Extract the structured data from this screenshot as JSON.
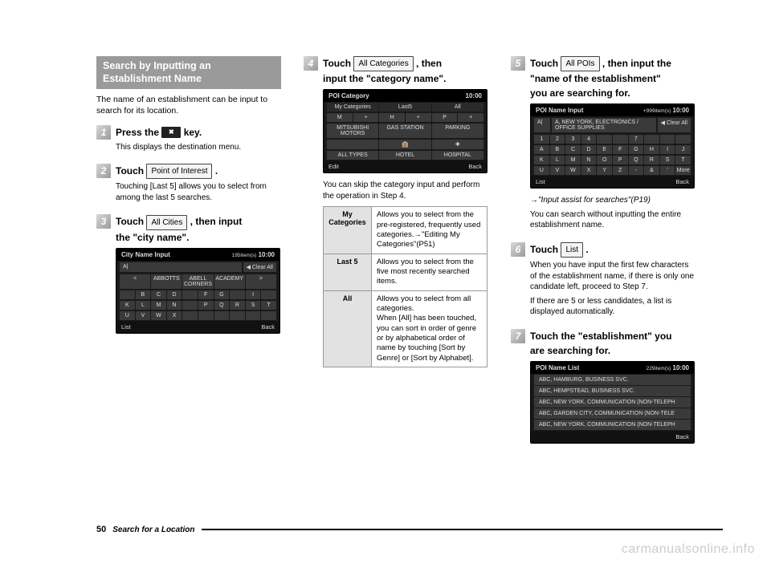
{
  "section_title_l1": "Search by Inputting an",
  "section_title_l2": "Establishment Name",
  "intro": "The name of an establishment can be input to search for its location.",
  "step1": {
    "main_a": "Press the ",
    "key": "✖",
    "main_b": " key.",
    "sub": "This displays the destination menu."
  },
  "step2": {
    "main_a": "Touch ",
    "btn": "Point of Interest",
    "main_b": " .",
    "sub": "Touching [Last 5] allows you to select from among the last 5 searches."
  },
  "step3": {
    "main_a": "Touch ",
    "btn": "All Cities",
    "main_b": " , then input",
    "main_c": "the \"city name\"."
  },
  "screen3": {
    "title": "City Name Input",
    "count": "195item(s)",
    "time": "10:00",
    "input": "A|",
    "clear": "◀ Clear All",
    "r1a": "ABBOTTS",
    "r1b": "ABELL CORNERS",
    "r1c": "ACADEMY",
    "k": [
      "B",
      "C",
      "D",
      "F",
      "G",
      "I",
      "K",
      "L",
      "M",
      "N",
      "P",
      "Q",
      "R",
      "S",
      "T",
      "U",
      "V",
      "W",
      "X"
    ],
    "f1": "List",
    "f2": "Back"
  },
  "step4": {
    "main_a": "Touch ",
    "btn": "All Categories",
    "main_b": " , then",
    "main_c": "input the \"category name\"."
  },
  "screen4": {
    "title": "POI Category",
    "time": "10:00",
    "t1": "My Categories",
    "t2": "Last5",
    "t3": "All",
    "r1a": "M",
    "r1b": "+",
    "r1c": "H",
    "r1d": "+",
    "r1e": "P",
    "r1f": "+",
    "r2a": "MITSUBISHI MOTORS",
    "r2b": "GAS STATION",
    "r2c": "PARKING",
    "r3a": "",
    "r3b": "🏨",
    "r3c": "✚",
    "r4a": "ALL TYPES",
    "r4b": "HOTEL",
    "r4c": "HOSPITAL",
    "f1": "Edit",
    "f2": "Back"
  },
  "step4_sub": "You can skip the category input and perform the operation in Step 4.",
  "table": {
    "r1l": "My Categories",
    "r1d": "Allows you to select from the pre-registered, frequently used categories.→\"Editing My Categories\"(P51)",
    "r2l": "Last 5",
    "r2d": "Allows you to select from the five most recently searched items.",
    "r3l": "All",
    "r3d": "Allows you to select from all categories.\nWhen [All] has been touched, you can sort in order of genre or by alphabetical order of name by touching [Sort by Genre] or [Sort by Alphabet]."
  },
  "step5": {
    "main_a": "Touch ",
    "btn": "All POIs",
    "main_b": " , then input the",
    "main_c": "\"name of the establishment\"",
    "main_d": "you are searching for."
  },
  "screen5": {
    "title": "POI Name Input",
    "count": "+999item(s)",
    "time": "10:00",
    "input": "A|",
    "sug": "A, NEW YORK, ELECTRONICS / OFFICE SUPPLIES",
    "clear": "◀ Clear All",
    "k1": [
      "1",
      "2",
      "3",
      "4",
      "",
      "",
      "7"
    ],
    "k2": [
      "A",
      "B",
      "C",
      "D",
      "E",
      "F",
      "G",
      "H",
      "I",
      "J"
    ],
    "k3": [
      "K",
      "L",
      "M",
      "N",
      "O",
      "P",
      "Q",
      "R",
      "S",
      "T"
    ],
    "k4": [
      "U",
      "V",
      "W",
      "X",
      "Y",
      "Z",
      "-",
      "&",
      "'",
      "More"
    ],
    "f1": "List",
    "f2": "Back"
  },
  "step5_ref": "→\"Input assist for searches\"(P19)",
  "step5_sub": "You can search without inputting the entire establishment name.",
  "step6": {
    "main_a": "Touch ",
    "btn": "List",
    "main_b": " .",
    "sub1": "When you have input the first few characters of the establishment name, if there is only one candidate left, proceed to Step 7.",
    "sub2": "If there are 5 or less candidates, a list is displayed automatically."
  },
  "step7": {
    "main_a": "Touch the \"establishment\" you",
    "main_b": "are searching for."
  },
  "screen7": {
    "title": "POI Name List",
    "count": "229item(s)",
    "time": "10:00",
    "i1": "ABC, HAMBURG, BUSINESS SVC.",
    "i2": "ABC, HEMPSTEAD, BUSINESS SVC.",
    "i3": "ABC, NEW YORK, COMMUNICATION (NON-TELEPH",
    "i4": "ABC, GARDEN CITY, COMMUNICATION (NON-TELE",
    "i5": "ABC, NEW YORK, COMMUNICATION (NON-TELEPH",
    "f2": "Back"
  },
  "footer": {
    "page": "50",
    "section": "Search for a Location"
  },
  "watermark": "carmanualsonline.info"
}
